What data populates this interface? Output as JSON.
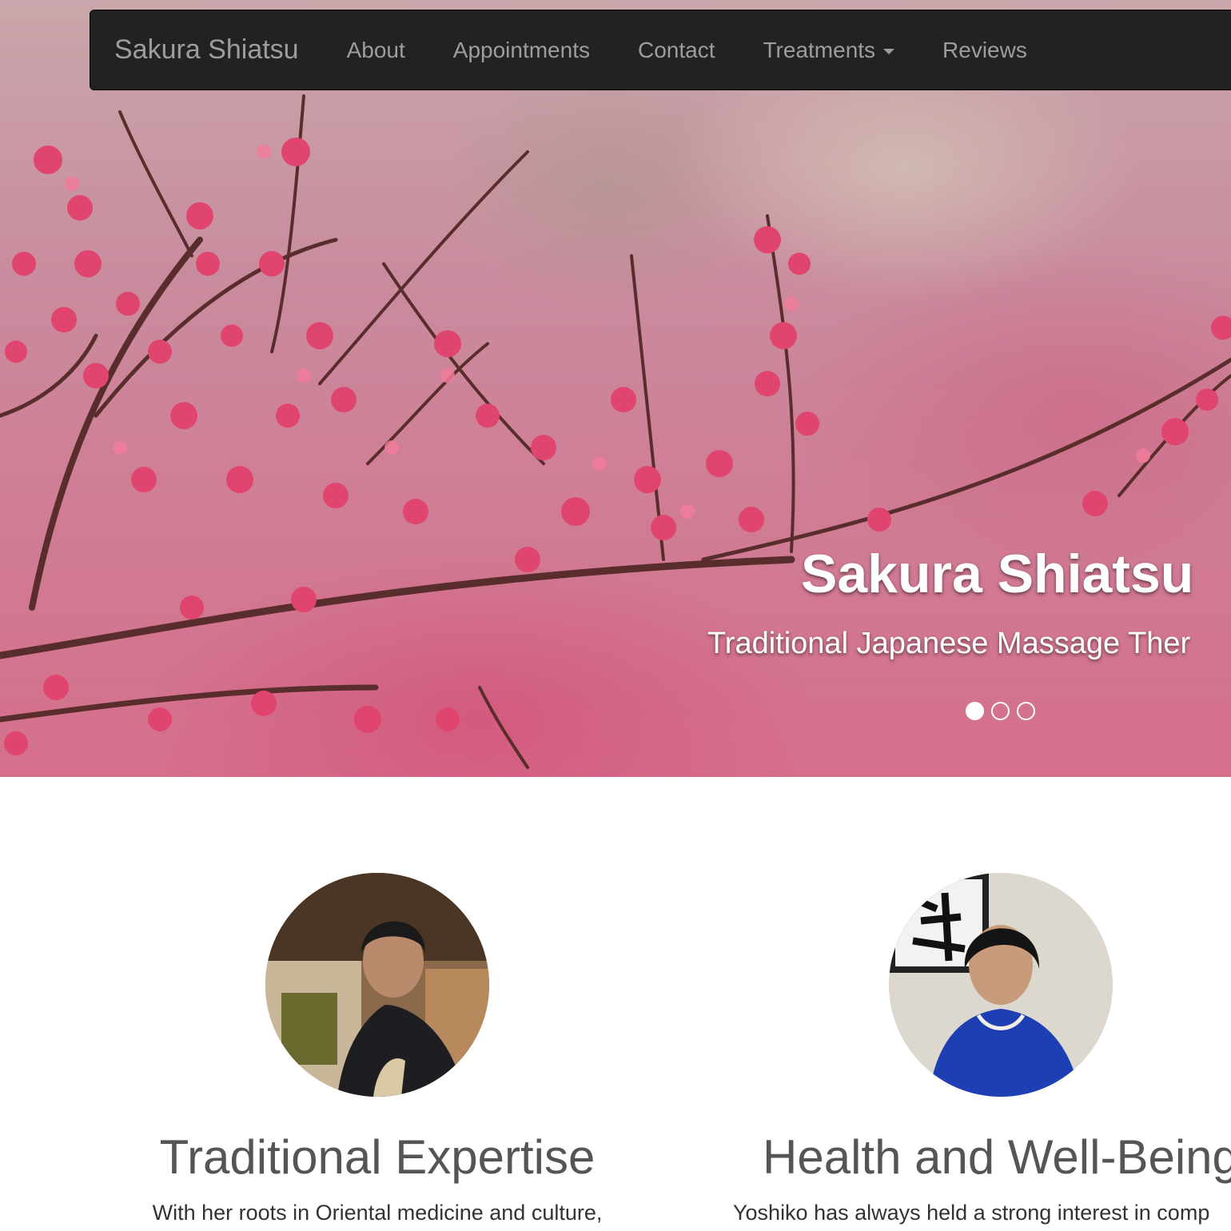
{
  "navbar": {
    "brand": "Sakura Shiatsu",
    "items": [
      {
        "label": "About"
      },
      {
        "label": "Appointments"
      },
      {
        "label": "Contact"
      },
      {
        "label": "Treatments",
        "dropdown": true
      },
      {
        "label": "Reviews"
      }
    ]
  },
  "carousel": {
    "title": "Sakura Shiatsu",
    "subtitle": "Traditional Japanese Massage Ther",
    "slide_count": 3,
    "active_slide": 1
  },
  "features": [
    {
      "heading": "Traditional Expertise",
      "text": "With her roots in Oriental medicine and culture,"
    },
    {
      "heading": "Health and Well-Being",
      "text": "Yoshiko has always held a strong interest in comp"
    }
  ],
  "colors": {
    "navbar_bg": "#222222",
    "nav_text": "#9d9d9d",
    "heading_text": "#555555",
    "body_text": "#333333",
    "blossom": "#e0456f"
  }
}
